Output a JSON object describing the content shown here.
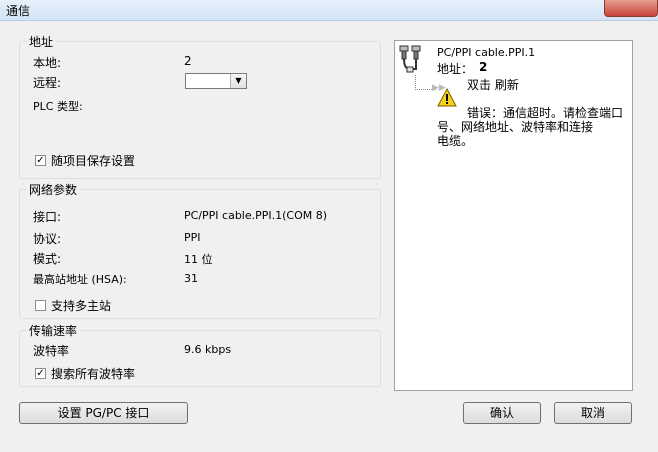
{
  "window": {
    "title": "通信"
  },
  "address_group": {
    "title": "地址",
    "local_label": "本地:",
    "local_value": "2",
    "remote_label": "远程:",
    "remote_value": "",
    "plc_type_label": "PLC 类型:",
    "save_with_project_label": "随项目保存设置",
    "save_with_project_checked": true
  },
  "network_group": {
    "title": "网络参数",
    "interface_label": "接口:",
    "interface_value": "PC/PPI cable.PPI.1(COM 8)",
    "protocol_label": "协议:",
    "protocol_value": "PPI",
    "mode_label": "模式:",
    "mode_value": "11 位",
    "hsa_label": "最高站地址 (HSA):",
    "hsa_value": "31",
    "multi_master_label": "支持多主站",
    "multi_master_checked": false
  },
  "baud_group": {
    "title": "传输速率",
    "baud_label": "波特率",
    "baud_value": "9.6 kbps",
    "search_all_label": "搜索所有波特率",
    "search_all_checked": true
  },
  "right_panel": {
    "device_name": "PC/PPI cable.PPI.1",
    "address_label": "地址：",
    "address_value": "2",
    "refresh_label": "双击 刷新",
    "error_text_line1": "错误：通信超时。请检查端口",
    "error_text_line2": "号、网络地址、波特率和连接",
    "error_text_line3": "电缆。"
  },
  "buttons": {
    "set_pgpc": "设置 PG/PC 接口",
    "ok": "确认",
    "cancel": "取消"
  },
  "colors": {
    "warning": "#f7d117",
    "titlebar": "#dbe8f6",
    "close": "#c8443a"
  }
}
